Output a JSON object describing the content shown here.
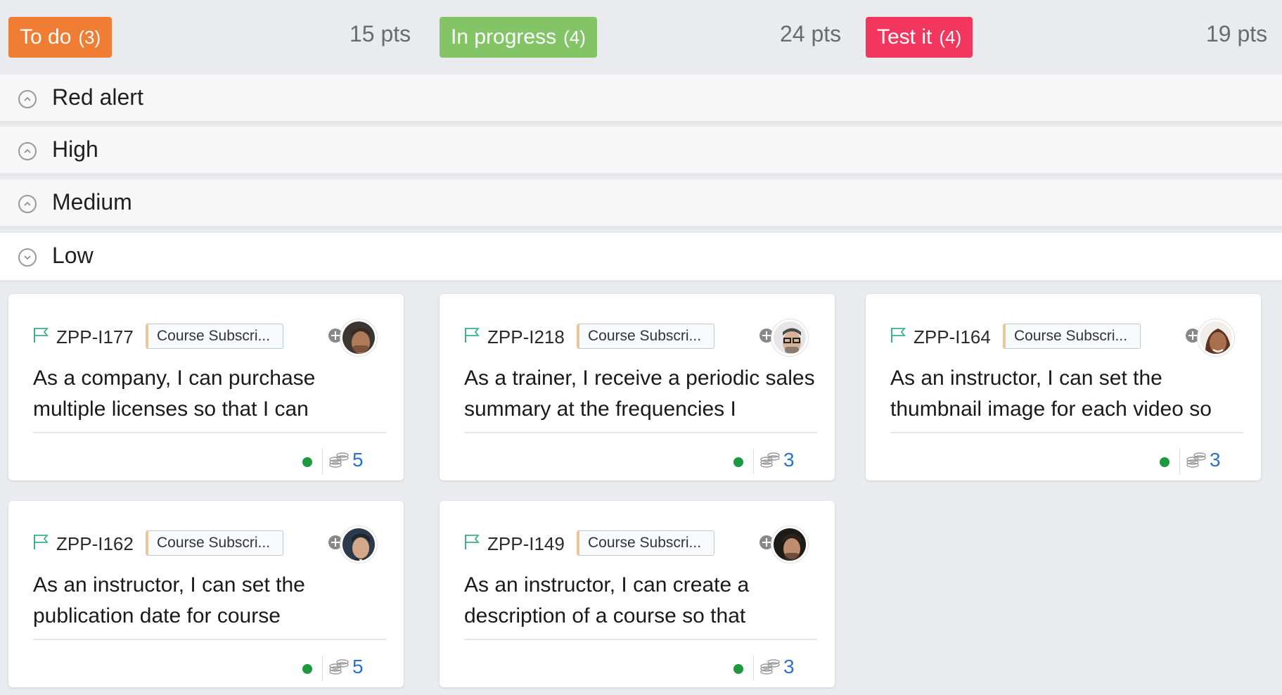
{
  "columns": [
    {
      "label": "To do",
      "count": "(3)",
      "points": "15 pts",
      "color": "#ef7d33"
    },
    {
      "label": "In progress",
      "count": "(4)",
      "points": "24 pts",
      "color": "#83c566"
    },
    {
      "label": "Test it",
      "count": "(4)",
      "points": "19 pts",
      "color": "#f2365e"
    }
  ],
  "lanes": [
    {
      "label": "Red alert",
      "state": "collapsed"
    },
    {
      "label": "High",
      "state": "collapsed"
    },
    {
      "label": "Medium",
      "state": "collapsed"
    },
    {
      "label": "Low",
      "state": "expanded"
    }
  ],
  "cards": [
    {
      "id": "ZPP-I177",
      "epic": "Course Subscri...",
      "text": "As a company, I can purchase multiple licenses so that I can",
      "points": "5",
      "avatar_skin": "#b07a5a",
      "avatar_hair": "#3a2a20"
    },
    {
      "id": "ZPP-I218",
      "epic": "Course Subscri...",
      "text": "As a trainer, I receive a periodic sales summary at the frequencies I",
      "points": "3",
      "avatar_skin": "#d8b39a",
      "avatar_hair": "#4a4a4a"
    },
    {
      "id": "ZPP-I164",
      "epic": "Course Subscri...",
      "text": "As an instructor, I can set the thumbnail image for each video so",
      "points": "3",
      "avatar_skin": "#a8704f",
      "avatar_hair": "#5a3322"
    },
    {
      "id": "ZPP-I162",
      "epic": "Course Subscri...",
      "text": "As an instructor, I can set the publication date for course",
      "points": "5",
      "avatar_skin": "#d3a98a",
      "avatar_hair": "#1f2630"
    },
    {
      "id": "ZPP-I149",
      "epic": "Course Subscri...",
      "text": "As an instructor, I can create a description of a course so that",
      "points": "3",
      "avatar_skin": "#c08e6e",
      "avatar_hair": "#2e241e"
    }
  ],
  "colors": {
    "status_dot": "#1d9a3f",
    "points_text": "#2a73c9",
    "flag": "#3fae8c"
  }
}
